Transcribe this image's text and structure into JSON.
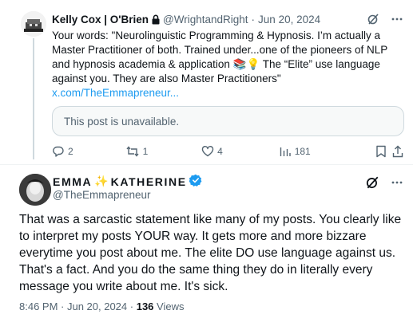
{
  "reply_tweet": {
    "author_name": "Kelly Cox | O'Brien",
    "handle": "@WrightandRight",
    "separator": "·",
    "date": "Jun 20, 2024",
    "text": "Your words: \"Neurolinguistic Programming & Hypnosis. I’m actually a Master Practitioner of both. Trained under...one of the pioneers of NLP and hypnosis academia & application 📚💡 The “Elite” use language against you. They are also Master Practitioners\"",
    "link_text": "x.com/TheEmmapreneur...",
    "quoted_post_text": "This post is unavailable.",
    "reply_count": "2",
    "repost_count": "1",
    "like_count": "4",
    "view_count": "181"
  },
  "main_tweet": {
    "display_name_first": "EMMA",
    "display_name_sparkle": "✨",
    "display_name_last": "KATHERINE",
    "handle": "@TheEmmapreneur",
    "text": "That was a sarcastic statement like many of my posts. You clearly like to interpret my posts YOUR way. It gets more and more bizzare everytime you post about me. The elite DO use language against us. That's a fact. And you do the same thing they do in literally every message you write about me. It's sick.",
    "timestamp": "8:46 PM · Jun 20, 2024",
    "meta_separator": " · ",
    "views_count": "136",
    "views_label": " Views"
  },
  "icons": [
    "avatar",
    "lock-icon",
    "grok-icon",
    "more-icon",
    "reply-icon",
    "repost-icon",
    "like-icon",
    "views-icon",
    "bookmark-icon",
    "share-icon",
    "verified-badge-icon"
  ],
  "colors": {
    "link": "#1d9bf0",
    "muted": "#536471",
    "text": "#0f1419",
    "verified": "#1d9bf0",
    "border": "#cfd9de"
  }
}
